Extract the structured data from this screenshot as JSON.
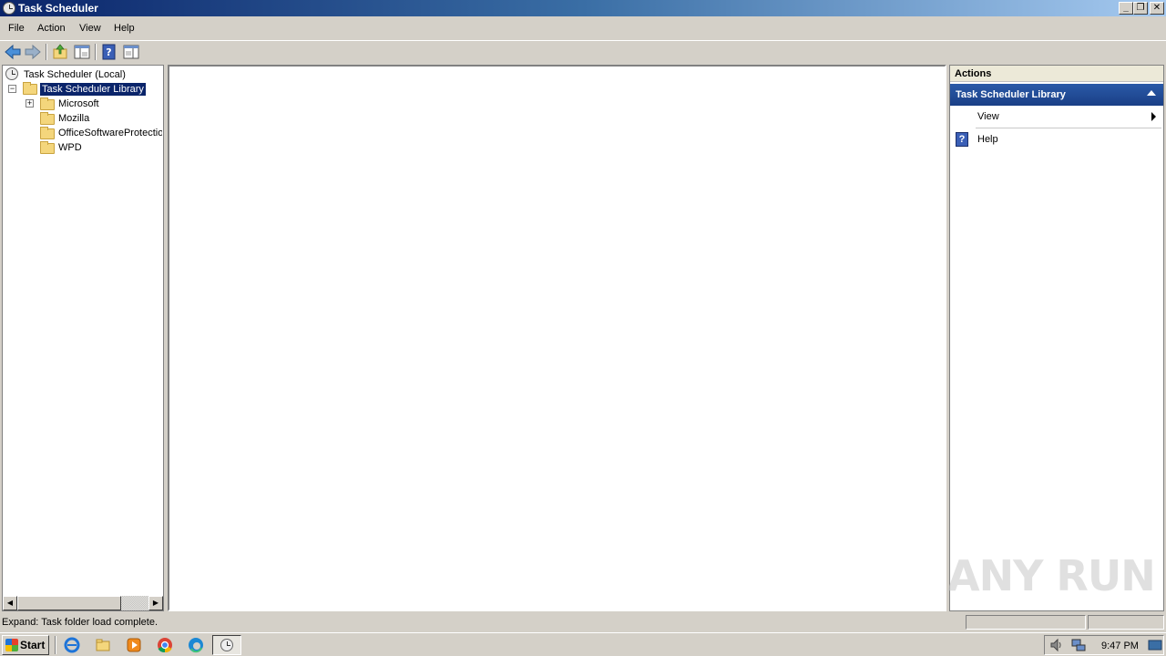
{
  "window": {
    "title": "Task Scheduler",
    "buttons": {
      "minimize": "_",
      "restore": "❐",
      "close": "✕"
    }
  },
  "menubar": {
    "items": [
      "File",
      "Action",
      "View",
      "Help"
    ]
  },
  "toolbar": {
    "icons": [
      "back-arrow-icon",
      "forward-arrow-icon",
      "up-folder-icon",
      "show-hide-console-tree-icon",
      "help-icon",
      "show-hide-action-pane-icon"
    ]
  },
  "tree": {
    "root": "Task Scheduler (Local)",
    "library": "Task Scheduler Library",
    "expander_minus": "−",
    "expander_plus": "+",
    "children": [
      "Microsoft",
      "Mozilla",
      "OfficeSoftwareProtectio",
      "WPD"
    ]
  },
  "actions": {
    "header": "Actions",
    "group_title": "Task Scheduler Library",
    "items": [
      {
        "label": "View",
        "has_submenu": true
      },
      {
        "label": "Help",
        "icon": "help-icon"
      }
    ]
  },
  "statusbar": {
    "text": "Expand:  Task folder load complete."
  },
  "watermark": "ANY RUN",
  "taskbar": {
    "start_label": "Start",
    "apps": [
      "internet-explorer-icon",
      "file-explorer-icon",
      "media-player-icon",
      "chrome-icon",
      "edge-icon",
      "task-scheduler-icon"
    ],
    "clock": "9:47 PM"
  }
}
